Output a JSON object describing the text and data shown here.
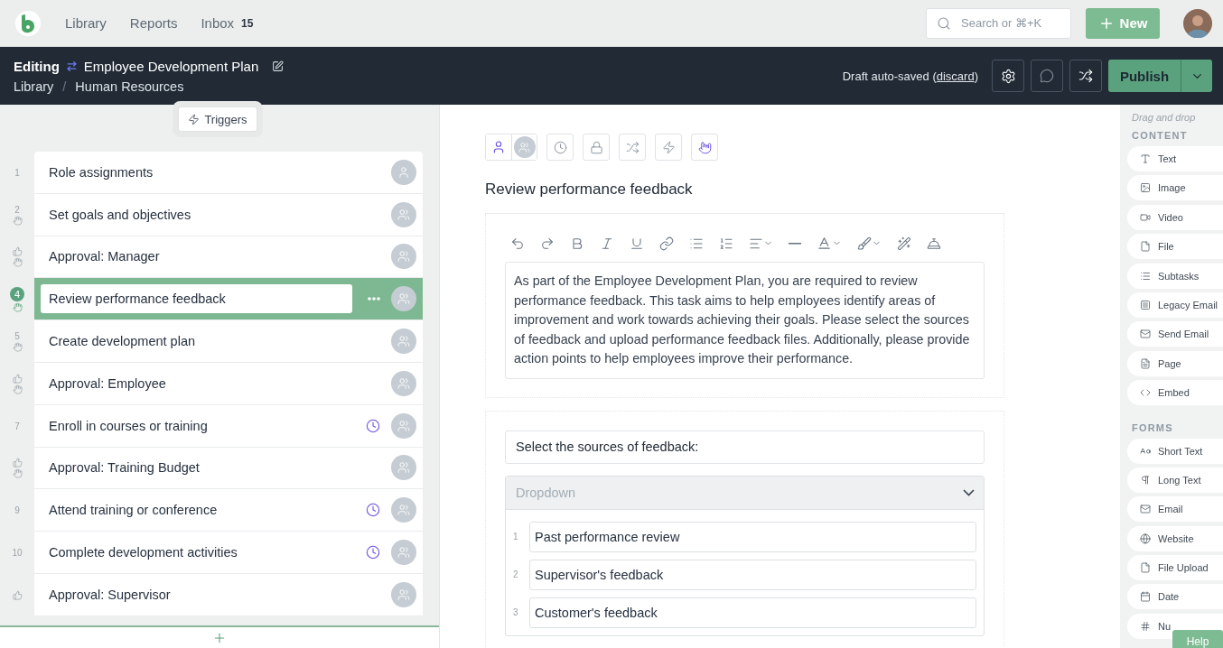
{
  "top_nav": {
    "links": [
      {
        "label": "Library"
      },
      {
        "label": "Reports"
      },
      {
        "label": "Inbox",
        "badge": "15"
      }
    ],
    "search": {
      "placeholder": "Search or ⌘+K"
    },
    "new_button": "New"
  },
  "header": {
    "mode": "Editing",
    "title": "Employee Development Plan",
    "breadcrumb": [
      "Library",
      "Human Resources"
    ],
    "breadcrumb_separator": "/",
    "status_before": "Draft auto-saved (",
    "discard_link": "discard",
    "status_after": ")",
    "publish_button": "Publish"
  },
  "triggers_button": "Triggers",
  "steps": [
    {
      "number": "1",
      "title": "Role assignments",
      "selected": false,
      "approval": false,
      "hand": false,
      "due": false,
      "group": false
    },
    {
      "number": "2",
      "title": "Set goals and objectives",
      "selected": false,
      "approval": false,
      "hand": true,
      "due": false,
      "group": true
    },
    {
      "title": "Approval: Manager",
      "selected": false,
      "approval": true,
      "hand": true,
      "due": false,
      "group": true
    },
    {
      "number": "4",
      "title": "Review performance feedback",
      "selected": true,
      "approval": false,
      "hand": true,
      "due": false,
      "group": true
    },
    {
      "number": "5",
      "title": "Create development plan",
      "selected": false,
      "approval": false,
      "hand": true,
      "due": false,
      "group": true
    },
    {
      "title": "Approval: Employee",
      "selected": false,
      "approval": true,
      "hand": true,
      "due": false,
      "group": true
    },
    {
      "number": "7",
      "title": "Enroll in courses or training",
      "selected": false,
      "approval": false,
      "hand": false,
      "due": true,
      "group": true
    },
    {
      "title": "Approval: Training Budget",
      "selected": false,
      "approval": true,
      "hand": true,
      "due": false,
      "group": true
    },
    {
      "number": "9",
      "title": "Attend training or conference",
      "selected": false,
      "approval": false,
      "hand": false,
      "due": true,
      "group": true
    },
    {
      "number": "10",
      "title": "Complete development activities",
      "selected": false,
      "approval": false,
      "hand": false,
      "due": true,
      "group": true
    },
    {
      "title": "Approval: Supervisor",
      "selected": false,
      "approval": true,
      "hand": false,
      "due": false,
      "group": true
    }
  ],
  "step_editor": {
    "title": "Review performance feedback",
    "description": "As part of the Employee Development Plan, you are required to review performance feedback. This task aims to help employees identify areas of improvement and work towards achieving their goals. Please select the sources of feedback and upload performance feedback files. Additionally, please provide action points to help employees improve their performance.",
    "form_label": "Select the sources of feedback:",
    "dropdown": {
      "placeholder": "Dropdown",
      "options": [
        {
          "number": "1",
          "value": "Past performance review"
        },
        {
          "number": "2",
          "value": "Supervisor's feedback"
        },
        {
          "number": "3",
          "value": "Customer's feedback"
        }
      ]
    }
  },
  "palette": {
    "hint": "Drag and drop",
    "sections": [
      {
        "heading": "CONTENT",
        "items": [
          {
            "label": "Text",
            "kind": "text"
          },
          {
            "label": "Image",
            "kind": "image"
          },
          {
            "label": "Video",
            "kind": "video"
          },
          {
            "label": "File",
            "kind": "file"
          },
          {
            "label": "Subtasks",
            "kind": "list"
          },
          {
            "label": "Legacy Email",
            "kind": "legacy"
          },
          {
            "label": "Send Email",
            "kind": "mail"
          },
          {
            "label": "Page",
            "kind": "page"
          },
          {
            "label": "Embed",
            "kind": "code"
          }
        ]
      },
      {
        "heading": "FORMS",
        "items": [
          {
            "label": "Short Text",
            "kind": "letter"
          },
          {
            "label": "Long Text",
            "kind": "pilcrow"
          },
          {
            "label": "Email",
            "kind": "mail"
          },
          {
            "label": "Website",
            "kind": "globe"
          },
          {
            "label": "File Upload",
            "kind": "file"
          },
          {
            "label": "Date",
            "kind": "calendar"
          },
          {
            "label": "Nu",
            "kind": "number"
          }
        ]
      }
    ],
    "help_button": "Help"
  }
}
